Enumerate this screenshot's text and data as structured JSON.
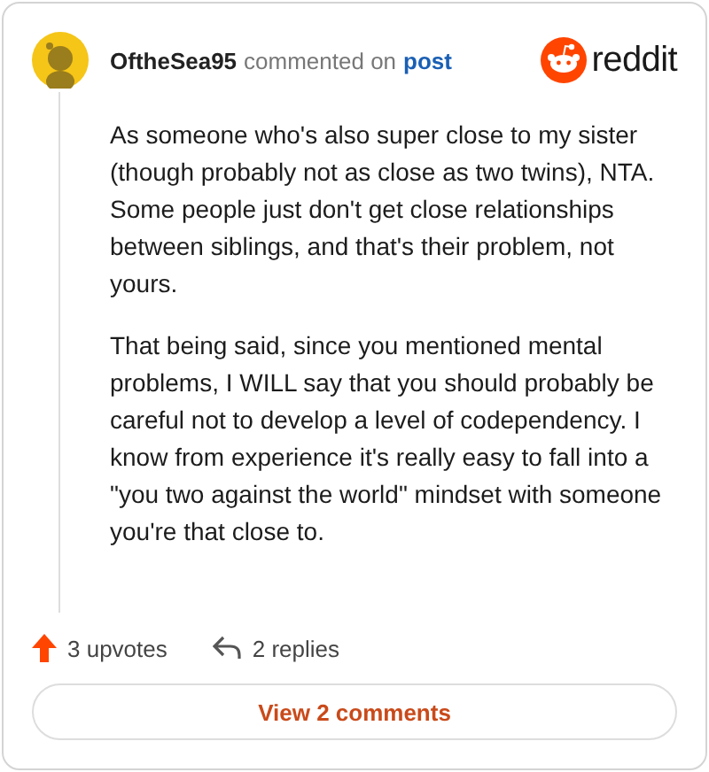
{
  "comment": {
    "author": "OftheSea95",
    "action": "commented on",
    "target": "post",
    "paragraphs": [
      "As someone who's also super close to my sister (though probably not as close as two twins), NTA. Some people just don't get close relationships between siblings, and that's their problem, not yours.",
      "That being said, since you mentioned mental problems, I WILL say that you should probably be careful not to develop a level of codependency. I know from experience it's really easy to fall into a \"you two against the world\" mindset with someone you're that close to."
    ]
  },
  "brand": "reddit",
  "footer": {
    "upvotes": "3 upvotes",
    "replies": "2 replies"
  },
  "button": "View 2 comments"
}
